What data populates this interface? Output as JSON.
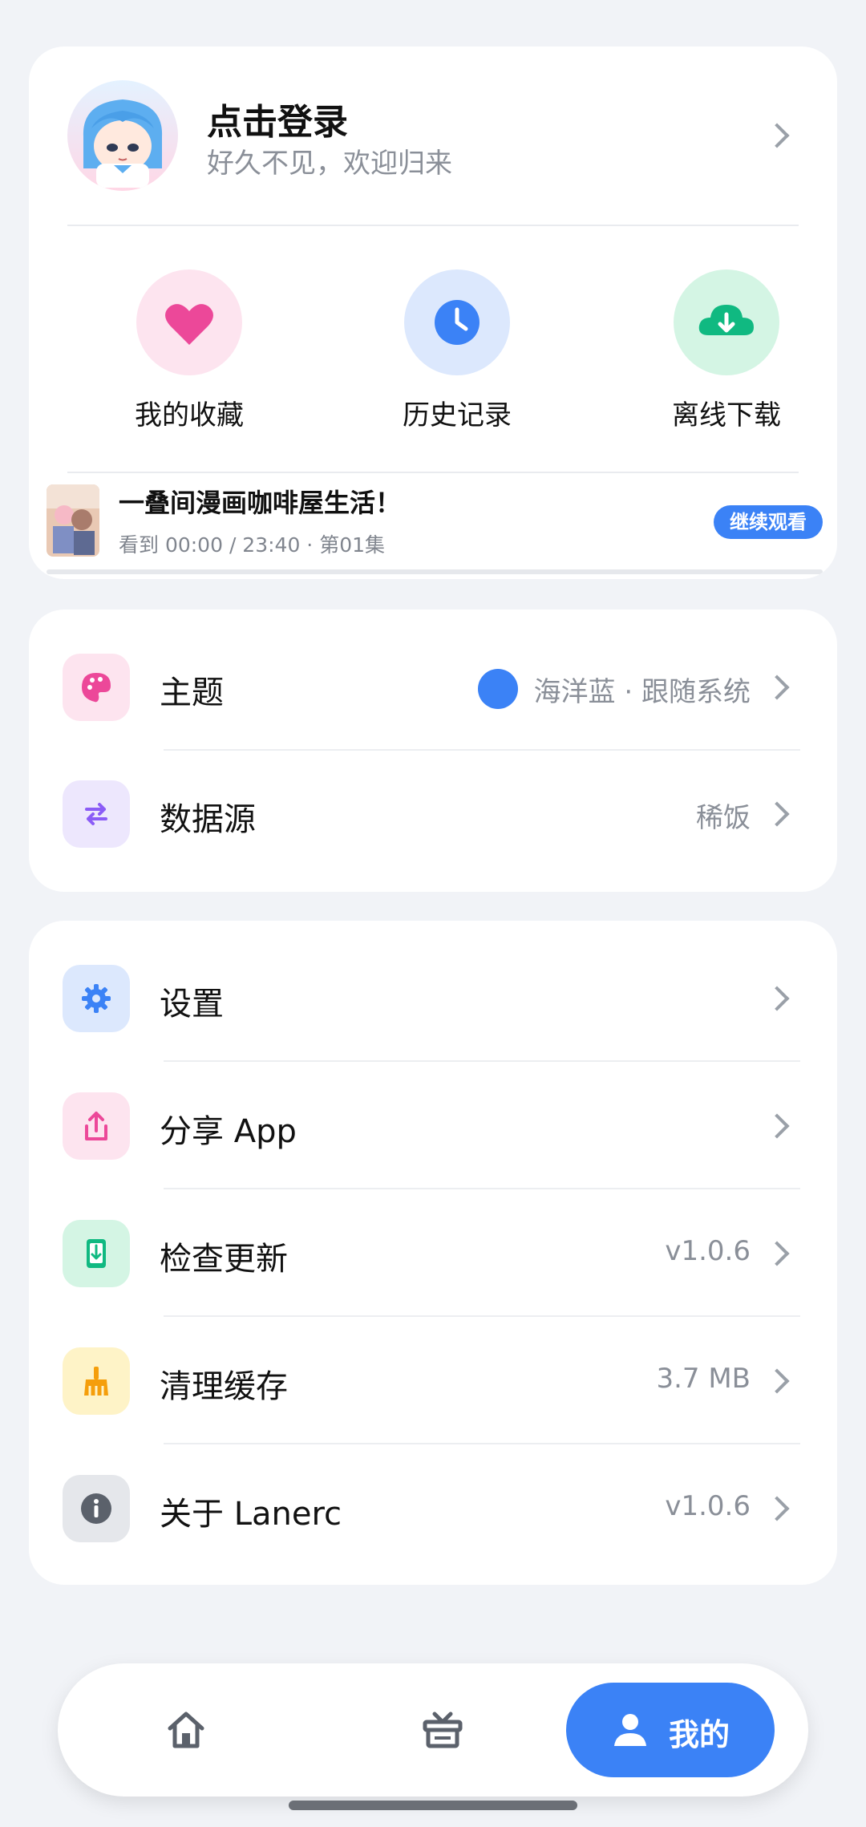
{
  "profile": {
    "title": "点击登录",
    "subtitle": "好久不见，欢迎归来"
  },
  "quick_actions": [
    {
      "label": "我的收藏",
      "icon": "heart-icon",
      "color": "#EC4899"
    },
    {
      "label": "历史记录",
      "icon": "clock-icon",
      "color": "#3B82F6"
    },
    {
      "label": "离线下载",
      "icon": "cloud-download-icon",
      "color": "#10B981"
    }
  ],
  "continue_watching": {
    "title": "一叠间漫画咖啡屋生活！",
    "progress_text": "看到 00:00 / 23:40 · 第01集",
    "button_label": "继续观看",
    "progress": 0
  },
  "theme_section": {
    "theme": {
      "label": "主题",
      "value": "海洋蓝 · 跟随系统",
      "swatch": "#3B82F6"
    },
    "source": {
      "label": "数据源",
      "value": "稀饭"
    }
  },
  "main_section": {
    "settings": {
      "label": "设置",
      "value": ""
    },
    "share": {
      "label": "分享 App",
      "value": ""
    },
    "update": {
      "label": "检查更新",
      "value": "v1.0.6"
    },
    "cache": {
      "label": "清理缓存",
      "value": "3.7 MB"
    },
    "about": {
      "label": "关于 Lanerc",
      "value": "v1.0.6"
    }
  },
  "bottom_nav": {
    "home_icon": "home-icon",
    "gift_icon": "gift-icon",
    "mine_label": "我的"
  },
  "colors": {
    "accent": "#3B82F6",
    "background": "#F1F3F7"
  }
}
